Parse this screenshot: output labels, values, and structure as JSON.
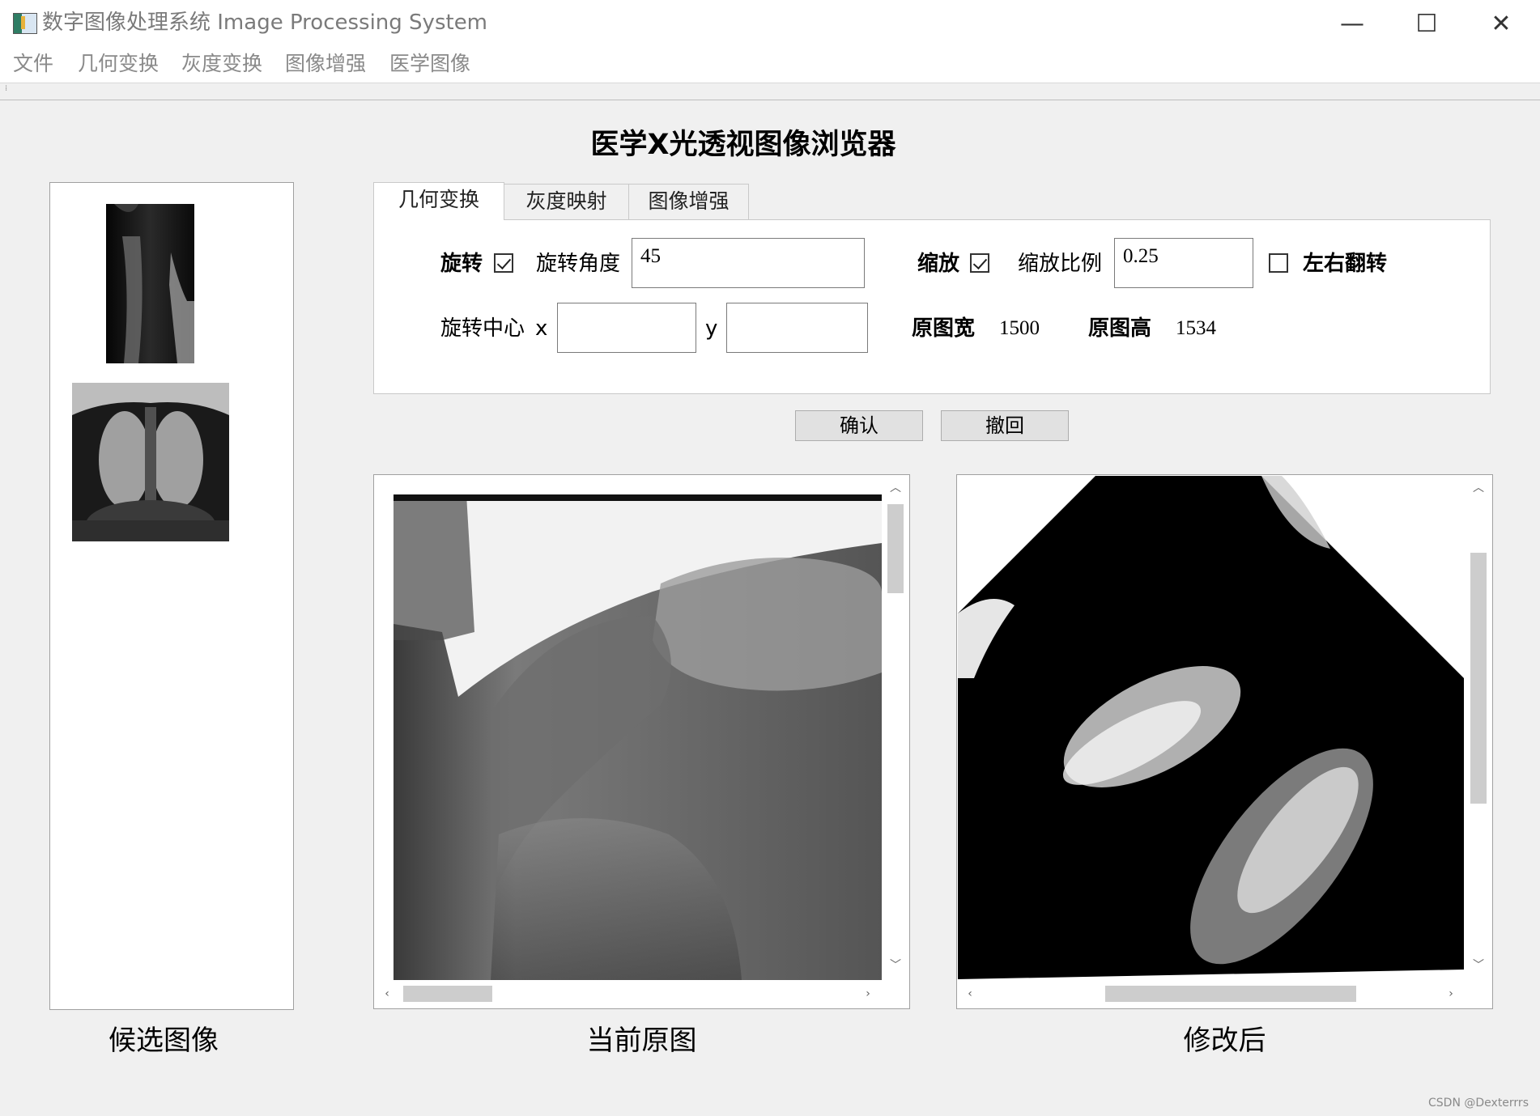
{
  "window": {
    "title": "数字图像处理系统 Image Processing System",
    "minimize_symbol": "—",
    "maximize_symbol": "☐",
    "close_symbol": "✕"
  },
  "menu": [
    "文件",
    "几何变换",
    "灰度变换",
    "图像增强",
    "医学图像"
  ],
  "page_title": "医学X光透视图像浏览器",
  "tabs": [
    "几何变换",
    "灰度映射",
    "图像增强"
  ],
  "controls": {
    "rotate_label": "旋转",
    "rotate_checked": true,
    "rotate_angle_label": "旋转角度",
    "rotate_angle_value": "45",
    "scale_label": "缩放",
    "scale_checked": true,
    "scale_ratio_label": "缩放比例",
    "scale_ratio_value": "0.25",
    "flip_label": "左右翻转",
    "flip_checked": false,
    "center_label": "旋转中心",
    "x_label": "x",
    "x_value": "",
    "y_label": "y",
    "y_value": "",
    "orig_width_label": "原图宽",
    "orig_width_value": "1500",
    "orig_height_label": "原图高",
    "orig_height_value": "1534"
  },
  "buttons": {
    "confirm": "确认",
    "undo": "撤回"
  },
  "captions": {
    "candidates": "候选图像",
    "current": "当前原图",
    "modified": "修改后"
  },
  "watermark": "CSDN @Dexterrrs",
  "colors": {
    "window_bg": "#f0f0f0",
    "panel_bg": "#ffffff",
    "menu_text": "#8a8a8a"
  }
}
